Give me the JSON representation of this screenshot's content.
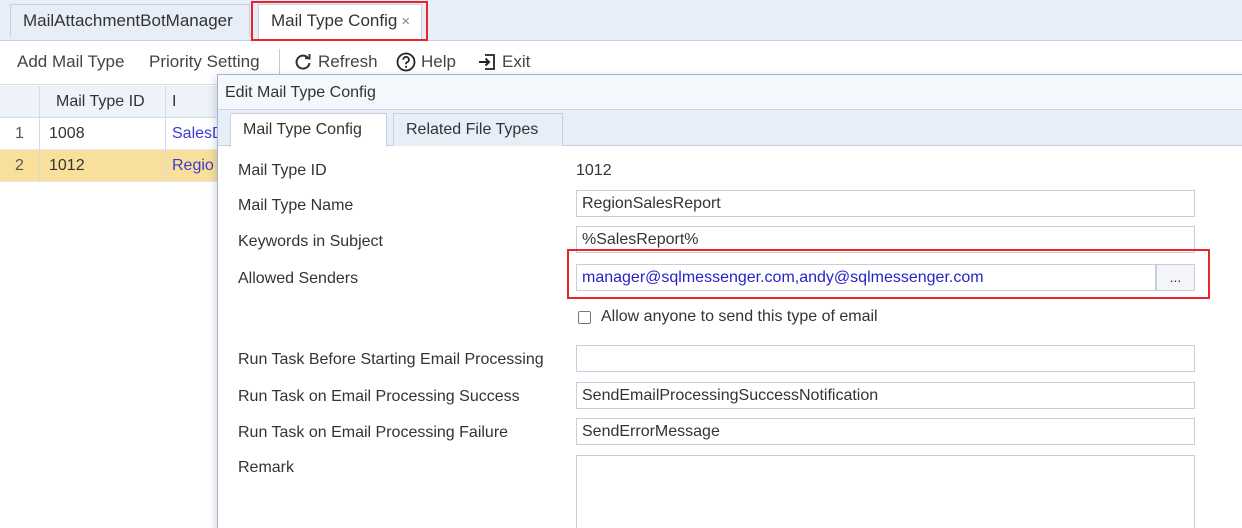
{
  "tabs": {
    "inactive_label": "MailAttachmentBotManager",
    "active_label": "Mail Type Config",
    "close_glyph": "×"
  },
  "toolbar": {
    "add_label": "Add Mail Type",
    "priority_label": "Priority Setting",
    "refresh_label": "Refresh",
    "help_label": "Help",
    "exit_label": "Exit"
  },
  "grid": {
    "header": {
      "row_num": "",
      "id": "Mail Type ID",
      "name": "I"
    },
    "rows": [
      {
        "num": "1",
        "id": "1008",
        "name": "SalesD",
        "selected": false
      },
      {
        "num": "2",
        "id": "1012",
        "name": "Regio",
        "selected": true
      }
    ]
  },
  "dialog": {
    "title": "Edit Mail Type Config",
    "tab_config": "Mail Type Config",
    "tab_related": "Related File Types",
    "fields": {
      "id_label": "Mail Type ID",
      "id_value": "1012",
      "name_label": "Mail Type Name",
      "name_value": "RegionSalesReport",
      "keywords_label": "Keywords in Subject",
      "keywords_value": "%SalesReport%",
      "senders_label": "Allowed Senders",
      "senders_value": "manager@sqlmessenger.com,andy@sqlmessenger.com",
      "senders_button": "...",
      "allow_anyone_label": "Allow anyone to send this type of email",
      "allow_anyone_checked": false,
      "before_label": "Run Task Before Starting Email Processing",
      "before_value": "",
      "success_label": "Run Task on Email Processing Success",
      "success_value": "SendEmailProcessingSuccessNotification",
      "failure_label": "Run Task on Email Processing Failure",
      "failure_value": "SendErrorMessage",
      "remark_label": "Remark",
      "remark_value": ""
    }
  },
  "colors": {
    "highlight": "#e8252a",
    "selected_row": "#f9e09a",
    "link_text": "#3b3bd6"
  },
  "icons": [
    "refresh-icon",
    "help-icon",
    "exit-icon"
  ]
}
